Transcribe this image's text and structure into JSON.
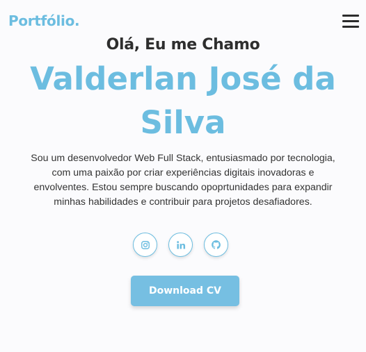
{
  "header": {
    "logo": "Portfólio."
  },
  "hero": {
    "greeting": "Olá, Eu me Chamo",
    "name": "Valderlan José da Silva",
    "bio": "Sou um desenvolvedor Web Full Stack, entusiasmado por tecnologia, com uma paixão por criar experiências digitais inovadoras e envolventes. Estou sempre buscando opoprtunidades para expandir minhas habilidades e contribuir para projetos desafiadores."
  },
  "socials": [
    {
      "icon": "instagram-icon"
    },
    {
      "icon": "linkedin-icon"
    },
    {
      "icon": "github-icon"
    }
  ],
  "cta": {
    "download_label": "Download CV"
  },
  "colors": {
    "accent": "#6cbde0",
    "button": "#76bfe2",
    "text": "#2b2b2b",
    "background": "#fbfbfd"
  }
}
